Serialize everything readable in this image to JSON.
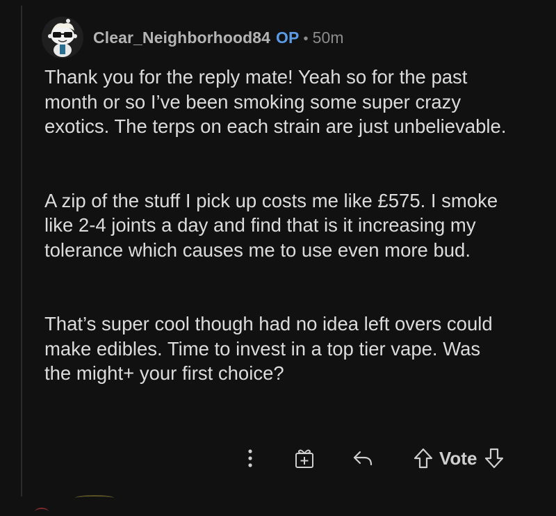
{
  "comment": {
    "username": "Clear_Neighborhood84",
    "op_badge": "OP",
    "separator": "•",
    "time": "50m",
    "avatar_icon": "snoo-avatar-with-sunglasses",
    "paragraphs": [
      "Thank you for the reply mate! Yeah so for the past\nmonth or so I’ve been smoking some super crazy\nexotics. The terps on each strain are just unbelievable.",
      "A zip of the stuff I pick up costs me like £575. I smoke\nlike 2-4 joints a day and find that is it increasing my\ntolerance which causes me to use even more bud.",
      "That’s super cool though had no idea left overs could\nmake edibles. Time to invest in a top tier vape. Was\nthe might+ your first choice?"
    ]
  },
  "actions": {
    "more_icon": "more-vertical-icon",
    "award_icon": "gift-award-icon",
    "reply_icon": "reply-icon",
    "upvote_icon": "upvote-arrow-icon",
    "vote_label": "Vote",
    "downvote_icon": "downvote-arrow-icon"
  },
  "colors": {
    "background": "#111111",
    "text": "#dcdcdc",
    "username": "#b4b4b4",
    "op_badge": "#5b9be6",
    "muted": "#8c8c8c"
  }
}
